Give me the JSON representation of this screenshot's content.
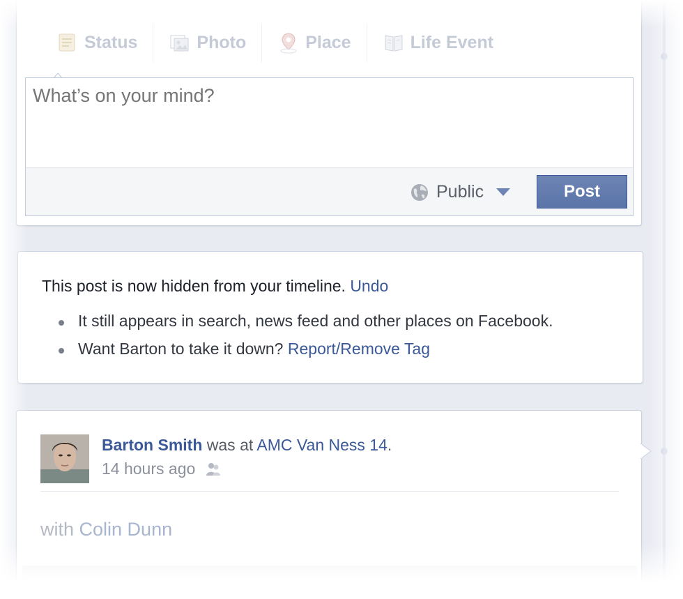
{
  "composer": {
    "tabs": [
      {
        "label": "Status",
        "icon": "status-icon"
      },
      {
        "label": "Photo",
        "icon": "photo-icon"
      },
      {
        "label": "Place",
        "icon": "place-icon"
      },
      {
        "label": "Life Event",
        "icon": "life-event-icon"
      }
    ],
    "placeholder": "What’s on your mind?",
    "privacy_label": "Public",
    "post_label": "Post"
  },
  "notice": {
    "message": "This post is now hidden from your timeline.",
    "undo_label": "Undo",
    "bullet1": "It still appears in search, news feed and other places on Facebook.",
    "bullet2_text": "Want Barton to take it down?",
    "bullet2_link": "Report/Remove Tag"
  },
  "story": {
    "author": "Barton Smith",
    "verb": "was at",
    "place": "AMC Van Ness 14",
    "time": "14 hours ago",
    "with_label": "with",
    "with_name": "Colin Dunn"
  },
  "colors": {
    "link": "#3b5998",
    "post_button": "#5b74a8",
    "page_bg": "#e9ebf2"
  }
}
